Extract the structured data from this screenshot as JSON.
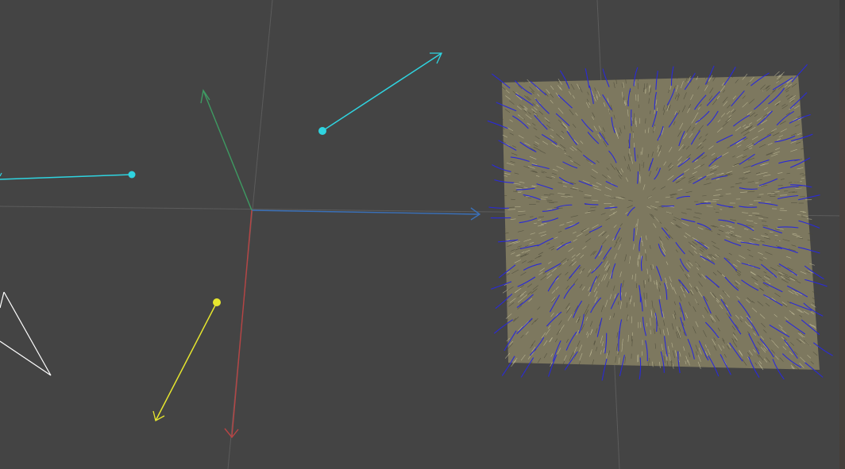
{
  "viewport": {
    "background": "#444444",
    "grid_color": "#5c5c5c"
  },
  "scene": {
    "objects": [
      {
        "name": "local-axes-gizmo",
        "kind": "transform-axes",
        "axes": [
          {
            "name": "x-axis",
            "color": "#3a70b8"
          },
          {
            "name": "y-axis",
            "color": "#3e9a62"
          },
          {
            "name": "z-axis",
            "color": "#b84444"
          }
        ]
      },
      {
        "name": "light-direction-cyan-upper",
        "kind": "directional-light",
        "color": "#2fd4e0"
      },
      {
        "name": "light-direction-cyan-left",
        "kind": "directional-light",
        "color": "#2fd4e0"
      },
      {
        "name": "light-direction-yellow",
        "kind": "directional-light",
        "color": "#e6e62e"
      },
      {
        "name": "camera-frustum-wireframe",
        "kind": "camera",
        "color": "#ffffff"
      },
      {
        "name": "particle-grid-object",
        "kind": "particle-system",
        "particle_color": "#9a9478",
        "vector_color": "#2a2ad8"
      }
    ]
  }
}
